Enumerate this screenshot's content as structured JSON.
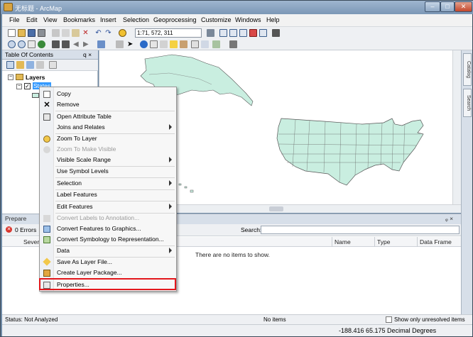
{
  "window": {
    "title": "无标题 - ArcMap"
  },
  "menubar": [
    "File",
    "Edit",
    "View",
    "Bookmarks",
    "Insert",
    "Selection",
    "Geoprocessing",
    "Customize",
    "Windows",
    "Help"
  ],
  "toolbar": {
    "scale_value": "1:71, 572, 311"
  },
  "toc": {
    "title": "Table Of Contents",
    "pin": "q ×",
    "layers_label": "Layers",
    "layer_name": "States"
  },
  "context_menu": {
    "items": [
      {
        "label": "Copy",
        "icon": "copy-icon",
        "enabled": true,
        "submenu": false
      },
      {
        "label": "Remove",
        "icon": "remove-icon",
        "enabled": true,
        "submenu": false
      },
      {
        "label": "Open Attribute Table",
        "icon": "table-icon",
        "enabled": true,
        "submenu": false
      },
      {
        "label": "Joins and Relates",
        "icon": "",
        "enabled": true,
        "submenu": true
      },
      {
        "label": "Zoom To Layer",
        "icon": "zoom-layer-icon",
        "enabled": true,
        "submenu": false
      },
      {
        "label": "Zoom To Make Visible",
        "icon": "zoom-visible-icon",
        "enabled": false,
        "submenu": false
      },
      {
        "label": "Visible Scale Range",
        "icon": "",
        "enabled": true,
        "submenu": true
      },
      {
        "label": "Use Symbol Levels",
        "icon": "",
        "enabled": true,
        "submenu": false
      },
      {
        "label": "Selection",
        "icon": "",
        "enabled": true,
        "submenu": true
      },
      {
        "label": "Label Features",
        "icon": "",
        "enabled": true,
        "submenu": false
      },
      {
        "label": "Edit Features",
        "icon": "",
        "enabled": true,
        "submenu": true
      },
      {
        "label": "Convert Labels to Annotation...",
        "icon": "convert-labels-icon",
        "enabled": false,
        "submenu": false
      },
      {
        "label": "Convert Features to Graphics...",
        "icon": "convert-features-icon",
        "enabled": true,
        "submenu": false
      },
      {
        "label": "Convert Symbology to Representation...",
        "icon": "convert-symbology-icon",
        "enabled": true,
        "submenu": false
      },
      {
        "label": "Data",
        "icon": "",
        "enabled": true,
        "submenu": true
      },
      {
        "label": "Save As Layer File...",
        "icon": "layer-file-icon",
        "enabled": true,
        "submenu": false
      },
      {
        "label": "Create Layer Package...",
        "icon": "layer-package-icon",
        "enabled": true,
        "submenu": false
      },
      {
        "label": "Properties...",
        "icon": "properties-icon",
        "enabled": true,
        "submenu": false
      }
    ]
  },
  "prepare": {
    "title": "Prepare",
    "errors": "0 Errors",
    "search_label": "Search:",
    "columns": [
      "Severi",
      "Name",
      "Type",
      "Data Frame"
    ],
    "empty_message": "There are no items to show."
  },
  "statusbar": {
    "prepare_status": "Status: Not Analyzed",
    "no_items": "No items",
    "show_unresolved": "Show only unresolved items",
    "coordinates": "-188.416  65.175 Decimal Degrees"
  },
  "dock_tabs": [
    "Catalog",
    "Search"
  ],
  "colors": {
    "highlight": "#e3171c",
    "map_fill": "#c9eee0",
    "selection": "#3399ff"
  }
}
